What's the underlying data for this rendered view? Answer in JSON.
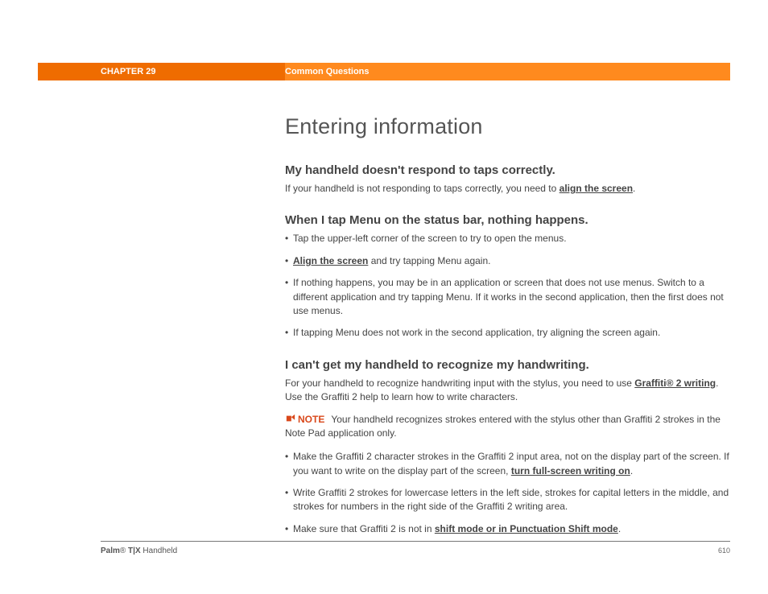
{
  "header": {
    "chapter": "CHAPTER 29",
    "section": "Common Questions"
  },
  "title": "Entering information",
  "q1": {
    "heading": "My handheld doesn't respond to taps correctly.",
    "text_before": "If your handheld is not responding to taps correctly, you need to ",
    "link": "align the screen",
    "text_after": "."
  },
  "q2": {
    "heading": "When I tap Menu on the status bar, nothing happens.",
    "items": [
      {
        "plain": "Tap the upper-left corner of the screen to try to open the menus."
      },
      {
        "link_first": "Align the screen",
        "after": " and try tapping Menu again."
      },
      {
        "plain": "If nothing happens, you may be in an application or screen that does not use menus. Switch to a different application and try tapping Menu. If it works in the second application, then the first does not use menus."
      },
      {
        "plain": "If tapping Menu does not work in the second application, try aligning the screen again."
      }
    ]
  },
  "q3": {
    "heading": "I can't get my handheld to recognize my handwriting.",
    "intro_before": "For your handheld to recognize handwriting input with the stylus, you need to use ",
    "intro_link": "Graffiti® 2 writing",
    "intro_after": ". Use the Graffiti 2 help to learn how to write characters.",
    "note_label": "NOTE",
    "note_text": "Your handheld recognizes strokes entered with the stylus other than Graffiti 2 strokes in the Note Pad application only.",
    "items": [
      {
        "before": "Make the Graffiti 2 character strokes in the Graffiti 2 input area, not on the display part of the screen. If you want to write on the display part of the screen, ",
        "link": "turn full-screen writing on",
        "after": "."
      },
      {
        "plain": "Write Graffiti 2 strokes for lowercase letters in the left side, strokes for capital letters in the middle, and strokes for numbers in the right side of the Graffiti 2 writing area."
      },
      {
        "before": "Make sure that Graffiti 2 is not in ",
        "link": "shift mode or in Punctuation Shift mode",
        "after": "."
      }
    ]
  },
  "footer": {
    "brand_bold": "Palm",
    "brand_reg": "®",
    "brand_model_bold": " T|X",
    "brand_tail": " Handheld",
    "page": "610"
  }
}
